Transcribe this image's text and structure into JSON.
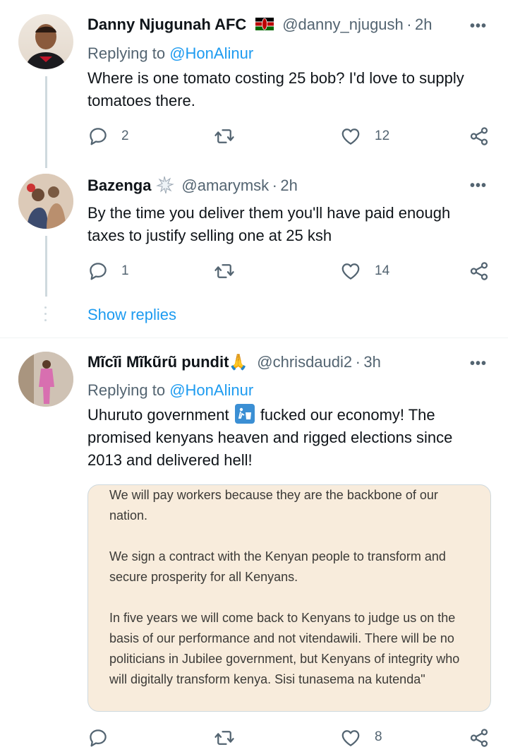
{
  "tweets": [
    {
      "name": "Danny Njugunah AFC",
      "handle": "@danny_njugush",
      "time": "2h",
      "reply_prefix": "Replying to",
      "reply_to": "@HonAlinur",
      "text": "Where is one tomato costing 25 bob? I'd love to supply tomatoes there.",
      "replies": "2",
      "retweets": "",
      "likes": "12"
    },
    {
      "name": "Bazenga",
      "handle": "@amarymsk",
      "time": "2h",
      "text": "By the time you deliver them you'll have paid enough taxes to justify selling one at 25 ksh",
      "replies": "1",
      "retweets": "",
      "likes": "14"
    },
    {
      "name": "Mĩcĩi Mĩkũrũ pundit🙏",
      "handle": "@chrisdaudi2",
      "time": "3h",
      "reply_prefix": "Replying to",
      "reply_to": "@HonAlinur",
      "text_before": "Uhuruto government",
      "text_after": "fucked our economy! The promised kenyans heaven and rigged elections since 2013 and delivered hell!",
      "replies": "",
      "retweets": "",
      "likes": "8"
    }
  ],
  "show_replies": "Show replies",
  "separator": "·",
  "quote_image": {
    "para1": "We will pay workers because they are the backbone of our nation.",
    "para2": "We sign a contract with the Kenyan people to transform and secure prosperity for all Kenyans.",
    "para3": "In five years we will come back to Kenyans to judge us on the basis of our performance and not vitendawili.  There will be no politicians in Jubilee government, but Kenyans of integrity who will digitally transform kenya. Sisi tunasema na kutenda\""
  },
  "colors": {
    "accent": "#1d9bf0",
    "muted": "#536471",
    "text": "#0f1419"
  },
  "icons": [
    "reply-icon",
    "retweet-icon",
    "like-icon",
    "share-icon",
    "more-icon",
    "kenya-flag-icon",
    "sparkle-icon",
    "trash-icon"
  ]
}
